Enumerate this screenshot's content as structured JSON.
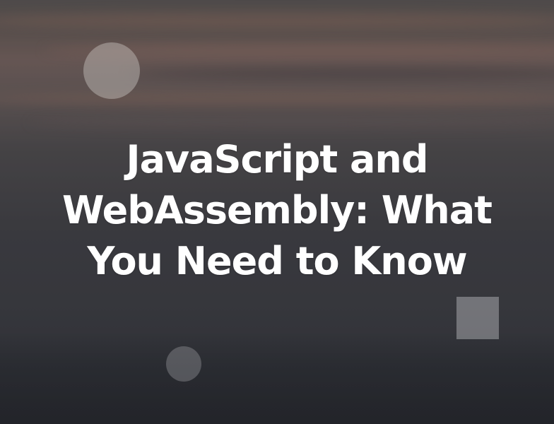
{
  "hero": {
    "title": "JavaScript and WebAssembly: What You Need to Know"
  },
  "colors": {
    "title_text": "#ffffff",
    "sky_warm": "#7a6560",
    "sea_dark": "#2e3036"
  }
}
